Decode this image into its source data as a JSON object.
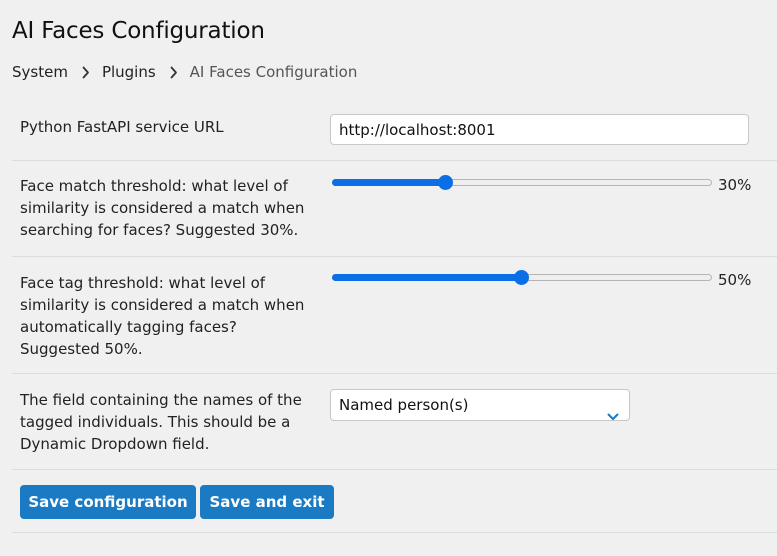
{
  "page": {
    "title": "AI Faces Configuration"
  },
  "breadcrumb": {
    "items": [
      "System",
      "Plugins",
      "AI Faces Configuration"
    ],
    "separator_icon": "chevron-right-icon"
  },
  "form": {
    "service_url": {
      "label": "Python FastAPI service URL",
      "value": "http://localhost:8001"
    },
    "face_match": {
      "label": "Face match threshold: what level of similarity is considered a match when searching for faces? Suggested 30%.",
      "value_percent": 30,
      "value_label": "30%"
    },
    "face_tag": {
      "label": "Face tag threshold: what level of similarity is considered a match when automatically tagging faces? Suggested 50%.",
      "value_percent": 50,
      "value_label": "50%"
    },
    "names_field": {
      "label": "The field containing the names of the tagged individuals. This should be a Dynamic Dropdown field.",
      "selected": "Named person(s)",
      "chevron_icon": "chevron-down-icon"
    }
  },
  "actions": {
    "save_label": "Save configuration",
    "save_exit_label": "Save and exit"
  },
  "colors": {
    "accent": "#0a6fe6",
    "button": "#1a7ac4",
    "background": "#f0f0f0"
  }
}
